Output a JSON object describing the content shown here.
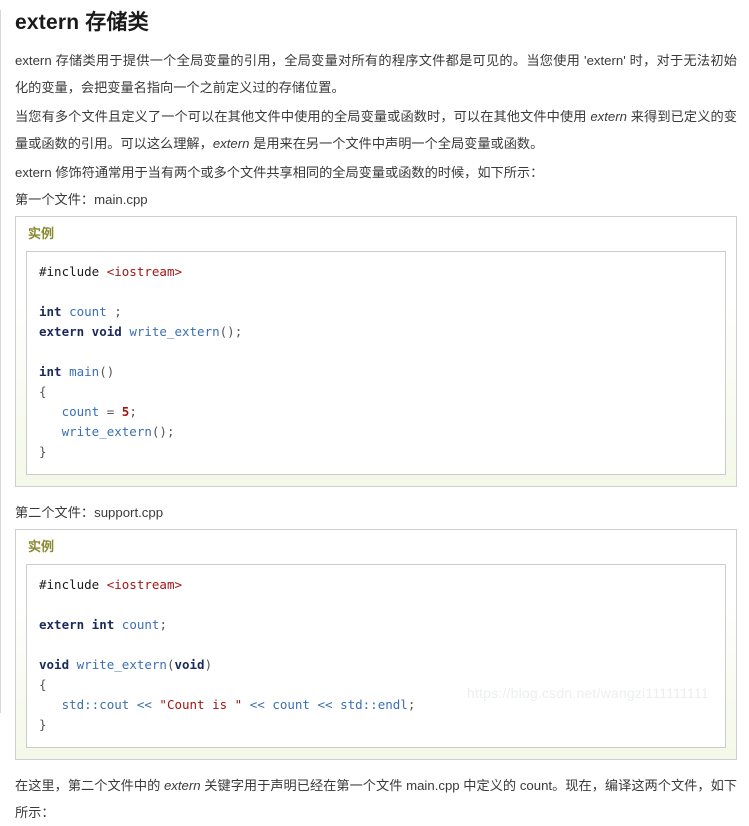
{
  "page": {
    "title": "extern 存储类",
    "watermark": "https://blog.csdn.net/wangzi111111111"
  },
  "paragraphs": {
    "p1": "extern 存储类用于提供一个全局变量的引用，全局变量对所有的程序文件都是可见的。当您使用 'extern' 时，对于无法初始化的变量，会把变量名指向一个之前定义过的存储位置。",
    "p2_a": "当您有多个文件且定义了一个可以在其他文件中使用的全局变量或函数时，可以在其他文件中使用 ",
    "p2_em1": "extern",
    "p2_b": " 来得到已定义的变量或函数的引用。可以这么理解，",
    "p2_em2": "extern",
    "p2_c": " 是用来在另一个文件中声明一个全局变量或函数。",
    "p3": "extern 修饰符通常用于当有两个或多个文件共享相同的全局变量或函数的时候，如下所示：",
    "p4_a": "在这里，第二个文件中的 ",
    "p4_em": "extern",
    "p4_b": " 关键字用于声明已经在第一个文件 main.cpp 中定义的 count。现在，编译这两个文件，如下所示："
  },
  "file1": {
    "label": "第一个文件：main.cpp",
    "example_label": "实例",
    "code_tokens": [
      {
        "t": "#include ",
        "c": "t-pre"
      },
      {
        "t": "<iostream>",
        "c": "t-inc"
      },
      {
        "t": "\n\n",
        "c": "t-pre"
      },
      {
        "t": "int",
        "c": "t-type"
      },
      {
        "t": " ",
        "c": "t-pre"
      },
      {
        "t": "count",
        "c": "t-id"
      },
      {
        "t": " ",
        "c": "t-pre"
      },
      {
        "t": ";",
        "c": "t-punct"
      },
      {
        "t": "\n",
        "c": "t-pre"
      },
      {
        "t": "extern void",
        "c": "t-type"
      },
      {
        "t": " ",
        "c": "t-pre"
      },
      {
        "t": "write_extern",
        "c": "t-id"
      },
      {
        "t": "();",
        "c": "t-punct"
      },
      {
        "t": "\n\n",
        "c": "t-pre"
      },
      {
        "t": "int",
        "c": "t-type"
      },
      {
        "t": " ",
        "c": "t-pre"
      },
      {
        "t": "main",
        "c": "t-id"
      },
      {
        "t": "()",
        "c": "t-punct"
      },
      {
        "t": "\n",
        "c": "t-pre"
      },
      {
        "t": "{",
        "c": "t-brace"
      },
      {
        "t": "\n   ",
        "c": "t-pre"
      },
      {
        "t": "count",
        "c": "t-id"
      },
      {
        "t": " = ",
        "c": "t-punct"
      },
      {
        "t": "5",
        "c": "t-num"
      },
      {
        "t": ";",
        "c": "t-punct"
      },
      {
        "t": "\n   ",
        "c": "t-pre"
      },
      {
        "t": "write_extern",
        "c": "t-id"
      },
      {
        "t": "();",
        "c": "t-punct"
      },
      {
        "t": "\n",
        "c": "t-pre"
      },
      {
        "t": "}",
        "c": "t-brace"
      }
    ],
    "code_plain": "#include <iostream>\n\nint count ;\nextern void write_extern();\n\nint main()\n{\n   count = 5;\n   write_extern();\n}"
  },
  "file2": {
    "label": "第二个文件：support.cpp",
    "example_label": "实例",
    "code_tokens": [
      {
        "t": "#include ",
        "c": "t-pre"
      },
      {
        "t": "<iostream>",
        "c": "t-inc"
      },
      {
        "t": "\n\n",
        "c": "t-pre"
      },
      {
        "t": "extern int",
        "c": "t-type"
      },
      {
        "t": " ",
        "c": "t-pre"
      },
      {
        "t": "count",
        "c": "t-id"
      },
      {
        "t": ";",
        "c": "t-punct"
      },
      {
        "t": "\n\n",
        "c": "t-pre"
      },
      {
        "t": "void",
        "c": "t-type"
      },
      {
        "t": " ",
        "c": "t-pre"
      },
      {
        "t": "write_extern",
        "c": "t-id"
      },
      {
        "t": "(",
        "c": "t-punct"
      },
      {
        "t": "void",
        "c": "t-type"
      },
      {
        "t": ")",
        "c": "t-punct"
      },
      {
        "t": "\n",
        "c": "t-pre"
      },
      {
        "t": "{",
        "c": "t-brace"
      },
      {
        "t": "\n   ",
        "c": "t-pre"
      },
      {
        "t": "std::cout",
        "c": "t-id"
      },
      {
        "t": " << ",
        "c": "t-op"
      },
      {
        "t": "\"Count is \"",
        "c": "t-str"
      },
      {
        "t": " << ",
        "c": "t-op"
      },
      {
        "t": "count",
        "c": "t-id"
      },
      {
        "t": " << ",
        "c": "t-op"
      },
      {
        "t": "std::endl",
        "c": "t-id"
      },
      {
        "t": ";",
        "c": "t-punct"
      },
      {
        "t": "\n",
        "c": "t-pre"
      },
      {
        "t": "}",
        "c": "t-brace"
      }
    ],
    "code_plain": "#include <iostream>\n\nextern int count;\n\nvoid write_extern(void)\n{\n   std::cout << \"Count is \" << count << std::endl;\n}"
  },
  "colors": {
    "example_label": "#8a8a33",
    "box_border": "#cfcfcf",
    "code_border": "#cccccc",
    "string": "#a31515",
    "identifier": "#3a6fb5",
    "keyword": "#1b2a5b",
    "watermark": "#eceef0"
  }
}
